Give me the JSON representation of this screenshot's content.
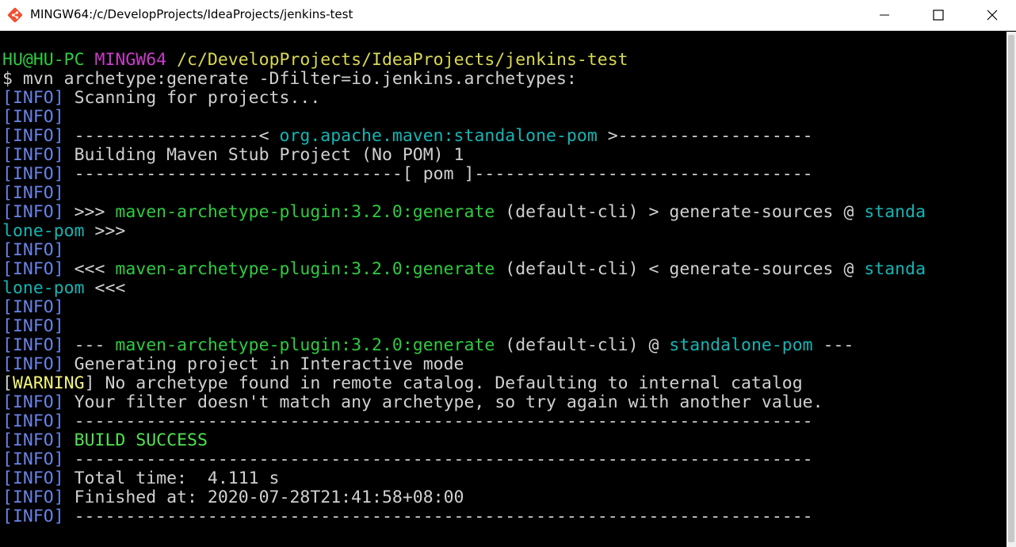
{
  "window": {
    "title": "MINGW64:/c/DevelopProjects/IdeaProjects/jenkins-test",
    "icon": "git-bash-icon"
  },
  "colors": {
    "default": "#d0d0d0",
    "green": "#2ecc40",
    "magenta": "#c93cc9",
    "yellow": "#d8d854",
    "cyan": "#16b4b4",
    "blue": "#6a83e6",
    "brightgreen": "#4fe34f",
    "warn": "#f4f47a"
  },
  "terminal": {
    "lines": [
      [
        {
          "t": "HU@HU-PC",
          "c": "green"
        },
        {
          "t": " "
        },
        {
          "t": "MINGW64",
          "c": "magenta"
        },
        {
          "t": " "
        },
        {
          "t": "/c/DevelopProjects/IdeaProjects/jenkins-test",
          "c": "yellow"
        }
      ],
      [
        {
          "t": "$ mvn archetype:generate -Dfilter=io.jenkins.archetypes:"
        }
      ],
      [
        {
          "t": "[INFO]",
          "c": "blue"
        },
        {
          "t": " Scanning for projects..."
        }
      ],
      [
        {
          "t": "[INFO]",
          "c": "blue"
        }
      ],
      [
        {
          "t": "[INFO]",
          "c": "blue"
        },
        {
          "t": " ------------------< "
        },
        {
          "t": "org.apache.maven:standalone-pom",
          "c": "cyan"
        },
        {
          "t": " >-------------------"
        }
      ],
      [
        {
          "t": "[INFO]",
          "c": "blue"
        },
        {
          "t": " Building Maven Stub Project (No POM) 1"
        }
      ],
      [
        {
          "t": "[INFO]",
          "c": "blue"
        },
        {
          "t": " --------------------------------[ pom ]---------------------------------"
        }
      ],
      [
        {
          "t": "[INFO]",
          "c": "blue"
        }
      ],
      [
        {
          "t": "[INFO]",
          "c": "blue"
        },
        {
          "t": " >>> "
        },
        {
          "t": "maven-archetype-plugin:3.2.0:generate",
          "c": "green"
        },
        {
          "t": " (default-cli) > generate-sources @ "
        },
        {
          "t": "standa",
          "c": "cyan"
        }
      ],
      [
        {
          "t": "lone-pom",
          "c": "cyan"
        },
        {
          "t": " >>>"
        }
      ],
      [
        {
          "t": "[INFO]",
          "c": "blue"
        }
      ],
      [
        {
          "t": "[INFO]",
          "c": "blue"
        },
        {
          "t": " <<< "
        },
        {
          "t": "maven-archetype-plugin:3.2.0:generate",
          "c": "green"
        },
        {
          "t": " (default-cli) < generate-sources @ "
        },
        {
          "t": "standa",
          "c": "cyan"
        }
      ],
      [
        {
          "t": "lone-pom",
          "c": "cyan"
        },
        {
          "t": " <<<"
        }
      ],
      [
        {
          "t": "[INFO]",
          "c": "blue"
        }
      ],
      [
        {
          "t": "[INFO]",
          "c": "blue"
        }
      ],
      [
        {
          "t": "[INFO]",
          "c": "blue"
        },
        {
          "t": " --- "
        },
        {
          "t": "maven-archetype-plugin:3.2.0:generate",
          "c": "green"
        },
        {
          "t": " (default-cli) @ "
        },
        {
          "t": "standalone-pom",
          "c": "cyan"
        },
        {
          "t": " ---"
        }
      ],
      [
        {
          "t": "[INFO]",
          "c": "blue"
        },
        {
          "t": " Generating project in Interactive mode"
        }
      ],
      [
        {
          "t": "[",
          "c": "default"
        },
        {
          "t": "WARNING",
          "c": "warn"
        },
        {
          "t": "] No archetype found in remote catalog. Defaulting to internal catalog"
        }
      ],
      [
        {
          "t": "[INFO]",
          "c": "blue"
        },
        {
          "t": " Your filter doesn't match any archetype, so try again with another value."
        }
      ],
      [
        {
          "t": "[INFO]",
          "c": "blue"
        },
        {
          "t": " ------------------------------------------------------------------------"
        }
      ],
      [
        {
          "t": "[INFO]",
          "c": "blue"
        },
        {
          "t": " "
        },
        {
          "t": "BUILD SUCCESS",
          "c": "brightgreen"
        }
      ],
      [
        {
          "t": "[INFO]",
          "c": "blue"
        },
        {
          "t": " ------------------------------------------------------------------------"
        }
      ],
      [
        {
          "t": "[INFO]",
          "c": "blue"
        },
        {
          "t": " Total time:  4.111 s"
        }
      ],
      [
        {
          "t": "[INFO]",
          "c": "blue"
        },
        {
          "t": " Finished at: 2020-07-28T21:41:58+08:00"
        }
      ],
      [
        {
          "t": "[INFO]",
          "c": "blue"
        },
        {
          "t": " ------------------------------------------------------------------------"
        }
      ]
    ]
  },
  "controls": {
    "minimize_icon": "minimize-icon",
    "maximize_icon": "maximize-icon",
    "close_icon": "close-icon"
  }
}
